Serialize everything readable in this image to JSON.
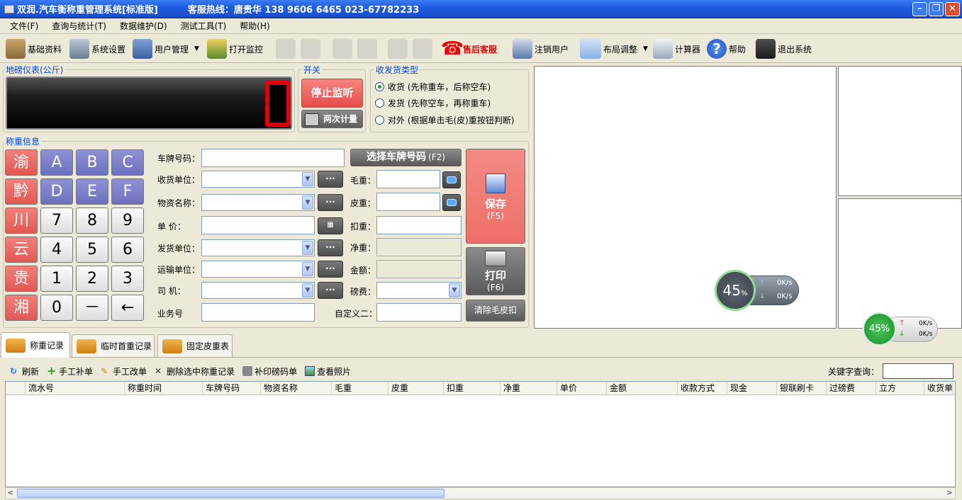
{
  "title": {
    "app": "双润.汽车衡称重管理系统[标准版]",
    "hotline": "客服热线：唐贵华 138 9606 6465  023-67782233"
  },
  "menu": [
    "文件(F)",
    "查询与统计(T)",
    "数据维护(D)",
    "测试工具(T)",
    "帮助(H)"
  ],
  "toolbar": {
    "basic": "基础资料",
    "settings": "系统设置",
    "users": "用户管理",
    "monitor": "打开监控",
    "service": "售后客服",
    "logout": "注销用户",
    "layout": "布局调整",
    "calc": "计算器",
    "help": "帮助",
    "exit": "退出系统"
  },
  "scale": {
    "label": "地磅仪表(公斤)",
    "reading": "0"
  },
  "switch": {
    "label": "开关",
    "stop": "停止监听",
    "twice": "两次计量"
  },
  "type": {
    "label": "收发货类型",
    "options": [
      "收货 (先称重车，后称空车)",
      "发货 (先称空车，再称重车)",
      "对外 (根据单击毛(皮)重按钮判断)"
    ],
    "selected": 0
  },
  "weigh": {
    "label": "称重信息"
  },
  "keypad": [
    [
      "渝",
      "A",
      "B",
      "C"
    ],
    [
      "黔",
      "D",
      "E",
      "F"
    ],
    [
      "川",
      "7",
      "8",
      "9"
    ],
    [
      "云",
      "4",
      "5",
      "6"
    ],
    [
      "贵",
      "1",
      "2",
      "3"
    ],
    [
      "湘",
      "0",
      "－",
      "←"
    ]
  ],
  "form": {
    "plate": "车牌号码：",
    "select_plate": "选择车牌号码",
    "select_key": "(F2)",
    "receiver": "收货单位：",
    "material": "物资名称：",
    "price": "单    价：",
    "sender": "发货单位：",
    "transport": "运输单位：",
    "driver": "司    机：",
    "bizno": "业务号",
    "gross": "毛重：",
    "tare": "皮重：",
    "deduct": "扣重：",
    "net": "净重：",
    "amount": "金额：",
    "fee": "磅费：",
    "custom2": "自定义二：",
    "dots": "···"
  },
  "actions": {
    "save": "保存",
    "save_key": "(F5)",
    "print": "打印",
    "print_key": "(F6)",
    "clear": "清除毛皮扣"
  },
  "net_widgets": [
    {
      "percent": "45",
      "unit": "%",
      "up": "0K/s",
      "down": "0K/s"
    },
    {
      "percent": "45%",
      "up": "0K/s",
      "down": "0K/s"
    }
  ],
  "tabs": [
    "称重记录",
    "临时首重记录",
    "固定皮重表"
  ],
  "subbar": {
    "refresh": "刷新",
    "manual_add": "手工补单",
    "manual_edit": "手工改单",
    "delete": "删除选中称重记录",
    "reprint": "补印磅码单",
    "photos": "查看照片",
    "keyword": "关键字查询："
  },
  "columns": [
    "流水号",
    "称重时间",
    "车牌号码",
    "物资名称",
    "毛重",
    "皮重",
    "扣重",
    "净重",
    "单价",
    "金额",
    "收款方式",
    "现金",
    "银联刷卡",
    "过磅费",
    "立方",
    "收货单"
  ]
}
